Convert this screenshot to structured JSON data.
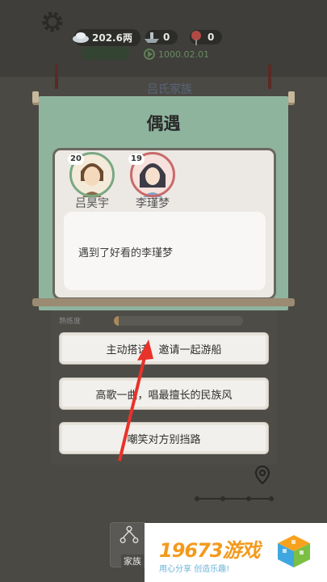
{
  "header": {
    "silver_amount": "202.6两",
    "item_count_a": "0",
    "item_count_b": "0",
    "timer": "1000.02.01",
    "family_name": "吕氏家族"
  },
  "dialog": {
    "title": "偶遇",
    "characters": [
      {
        "name": "吕昊宇",
        "level": "20",
        "frame_color": "#7aa882"
      },
      {
        "name": "李瑾梦",
        "level": "19",
        "frame_color": "#c86a6a"
      }
    ],
    "event_text": "遇到了好看的李瑾梦"
  },
  "skill": {
    "label": "熟练度",
    "progress": 0.04
  },
  "options": [
    "主动搭话，邀请一起游船",
    "高歌一曲，唱最擅长的民族风",
    "嘲笑对方别挡路"
  ],
  "bottom_nav": {
    "family_label": "家族"
  },
  "watermark": {
    "brand": "19673游戏",
    "slogan": "用心分享  创造乐趣!"
  }
}
